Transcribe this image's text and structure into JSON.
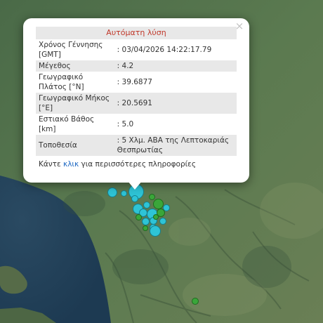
{
  "popup": {
    "title": "Αυτόματη λύση",
    "close_symbol": "×",
    "rows": [
      {
        "label": "Χρόνος Γέννησης [GMT]",
        "value": ": 03/04/2026 14:22:17.79"
      },
      {
        "label": "Μέγεθος",
        "value": ": 4.2"
      },
      {
        "label": "Γεωγραφικό Πλάτος [°N]",
        "value": ": 39.6877"
      },
      {
        "label": "Γεωγραφικό Μήκος [°E]",
        "value": ": 20.5691"
      },
      {
        "label": "Εστιακό Βάθος [km]",
        "value": ": 5.0"
      },
      {
        "label": "Τοποθεσία",
        "value": ": 5 Χλμ. ΑΒΑ της Λεπτοκαριάς Θεσπρωτίας"
      }
    ],
    "more_prefix": "Κάντε ",
    "more_link": "κλικ",
    "more_suffix": " για περισσότερες πληροφορίες"
  },
  "map": {
    "marker_colors": {
      "cyan": "#2ec4d6",
      "green": "#3aa63a"
    }
  }
}
